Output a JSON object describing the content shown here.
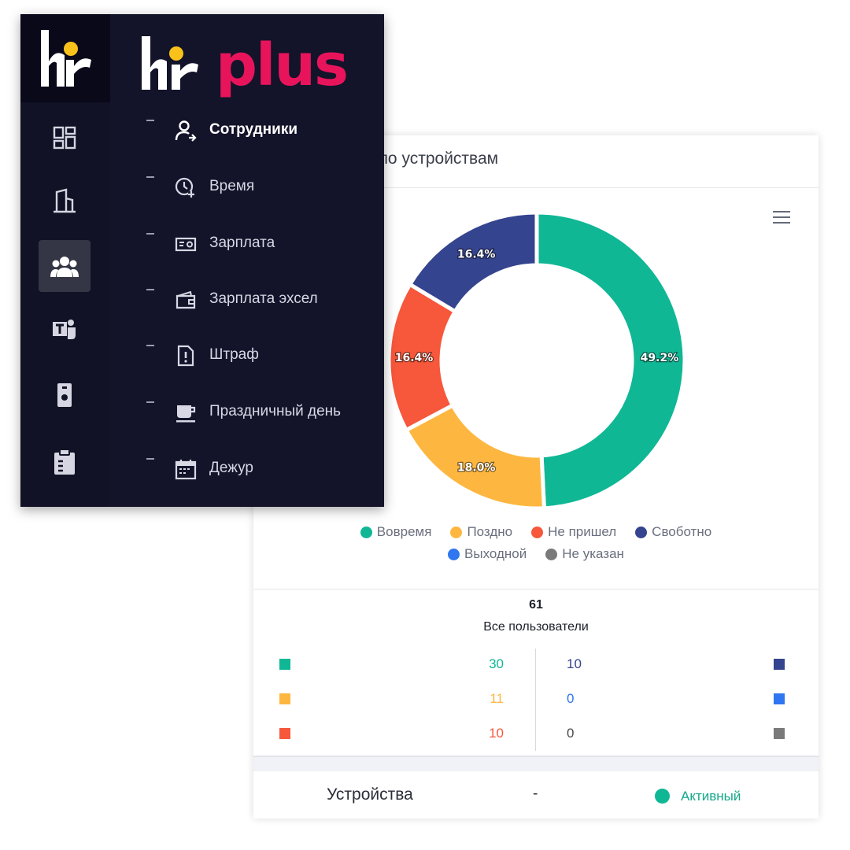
{
  "card": {
    "title": "и по устройствам",
    "menu_icon": "hamburger-icon",
    "total_value": "61",
    "total_label": "Все пользователи",
    "devices_label": "Устройства",
    "devices_value": "-",
    "devices_status": "Активный"
  },
  "chart_data": {
    "type": "pie",
    "categories": [
      "Вовремя",
      "Поздно",
      "Не пришел",
      "Своботно",
      "Выходной",
      "Не указан"
    ],
    "values": [
      49.2,
      18.0,
      16.4,
      16.4,
      0,
      0
    ],
    "labels": [
      "49.2%",
      "18.0%",
      "16.4%",
      "16.4%"
    ],
    "colors": [
      "#10b795",
      "#fdb740",
      "#f7573b",
      "#35448e",
      "#2f76f0",
      "#7a7a7a"
    ],
    "legend_position": "bottom"
  },
  "legend": {
    "row1": [
      {
        "label": "Вовремя",
        "color": "#10b795"
      },
      {
        "label": "Поздно",
        "color": "#fdb740"
      },
      {
        "label": "Не пришел",
        "color": "#f7573b"
      },
      {
        "label": "Своботно",
        "color": "#35448e"
      }
    ],
    "row2": [
      {
        "label": "Выходной",
        "color": "#2f76f0"
      },
      {
        "label": "Не указан",
        "color": "#7a7a7a"
      }
    ]
  },
  "stats": {
    "left": [
      {
        "value": "30",
        "color": "#10b795"
      },
      {
        "value": "11",
        "color": "#fdb740"
      },
      {
        "value": "10",
        "color": "#f7573b"
      }
    ],
    "right": [
      {
        "value": "10",
        "color": "#35448e",
        "text_color": "#35448e"
      },
      {
        "value": "0",
        "color": "#2f76f0",
        "text_color": "#2f76f0"
      },
      {
        "value": "0",
        "color": "#7a7a7a",
        "text_color": "#4a4a4a"
      }
    ]
  },
  "sidebar": {
    "brand": {
      "hr": "hr",
      "plus": "plus",
      "plus_color": "#e8145b",
      "dot_color": "#f9c21b"
    },
    "rail_icons": [
      {
        "name": "dashboard-icon",
        "active": false
      },
      {
        "name": "building-icon",
        "active": false
      },
      {
        "name": "users-icon",
        "active": true
      },
      {
        "name": "teams-icon",
        "active": false
      },
      {
        "name": "device-icon",
        "active": false
      },
      {
        "name": "clipboard-icon",
        "active": false
      }
    ],
    "menu": [
      {
        "label": "Сотрудники",
        "icon": "user-add-icon",
        "active": true
      },
      {
        "label": "Время",
        "icon": "clock-plus-icon",
        "active": false
      },
      {
        "label": "Зарплата",
        "icon": "money-icon",
        "active": false
      },
      {
        "label": "Зарплата эхсел",
        "icon": "wallet-icon",
        "active": false
      },
      {
        "label": "Штраф",
        "icon": "penalty-file-icon",
        "active": false
      },
      {
        "label": "Праздничный день",
        "icon": "coffee-cup-icon",
        "active": false
      },
      {
        "label": "Дежур",
        "icon": "calendar-icon",
        "active": false
      }
    ]
  }
}
